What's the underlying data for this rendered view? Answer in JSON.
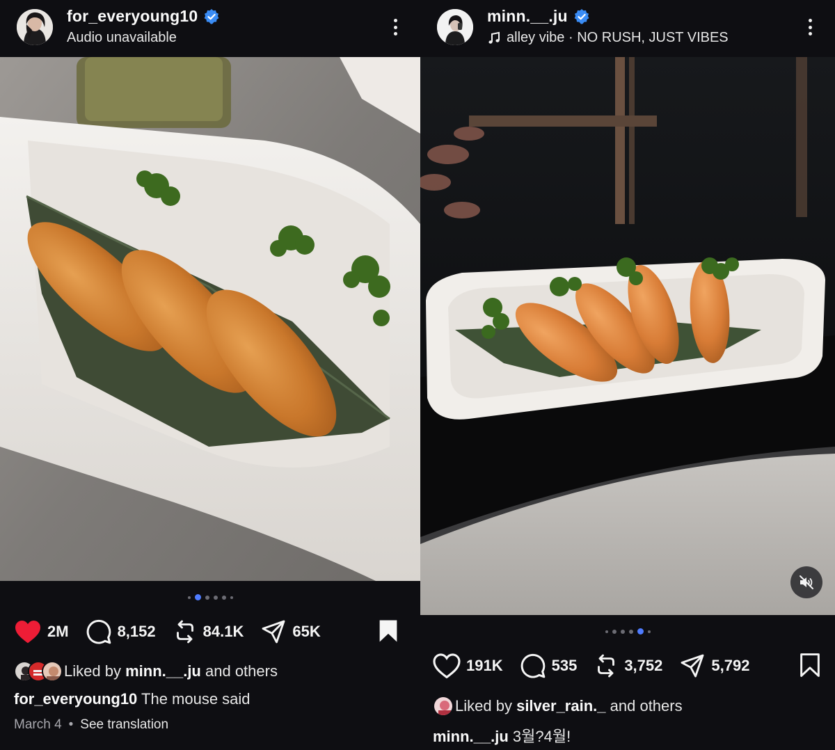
{
  "left_post": {
    "username": "for_everyoung10",
    "subtitle": "Audio unavailable",
    "carousel": {
      "count": 6,
      "active": 1
    },
    "likes": "2M",
    "comments": "8,152",
    "reposts": "84.1K",
    "shares": "65K",
    "liked_by_prefix": "Liked by",
    "liked_by_user": "minn.__.ju",
    "liked_by_suffix": "and others",
    "caption_user": "for_everyoung10",
    "caption_text": "The mouse said",
    "date": "March 4",
    "separator": "•",
    "see_translation": "See translation",
    "liked": true
  },
  "right_post": {
    "username": "minn.__.ju",
    "song": "alley vibe",
    "song_separator": "·",
    "artist": "NO RUSH, JUST VIBES",
    "carousel": {
      "count": 6,
      "active": 4
    },
    "likes": "191K",
    "comments": "535",
    "reposts": "3,752",
    "shares": "5,792",
    "liked_by_prefix": "Liked by",
    "liked_by_user": "silver_rain._",
    "liked_by_suffix": "and others",
    "caption_user": "minn.__.ju",
    "caption_text": "3월?4월!",
    "liked": false
  },
  "icons": {
    "verified": "verified-badge-icon",
    "more": "more-options-icon",
    "like": "heart-icon",
    "comment": "comment-icon",
    "repost": "repost-icon",
    "share": "send-icon",
    "bookmark": "bookmark-icon",
    "music": "music-note-icon",
    "mute": "speaker-muted-icon"
  },
  "colors": {
    "background": "#0e0e12",
    "like_red": "#ee1d36",
    "verified_blue": "#3a8cf5",
    "active_dot": "#4f7cff",
    "muted_text": "#a8a8ae"
  }
}
